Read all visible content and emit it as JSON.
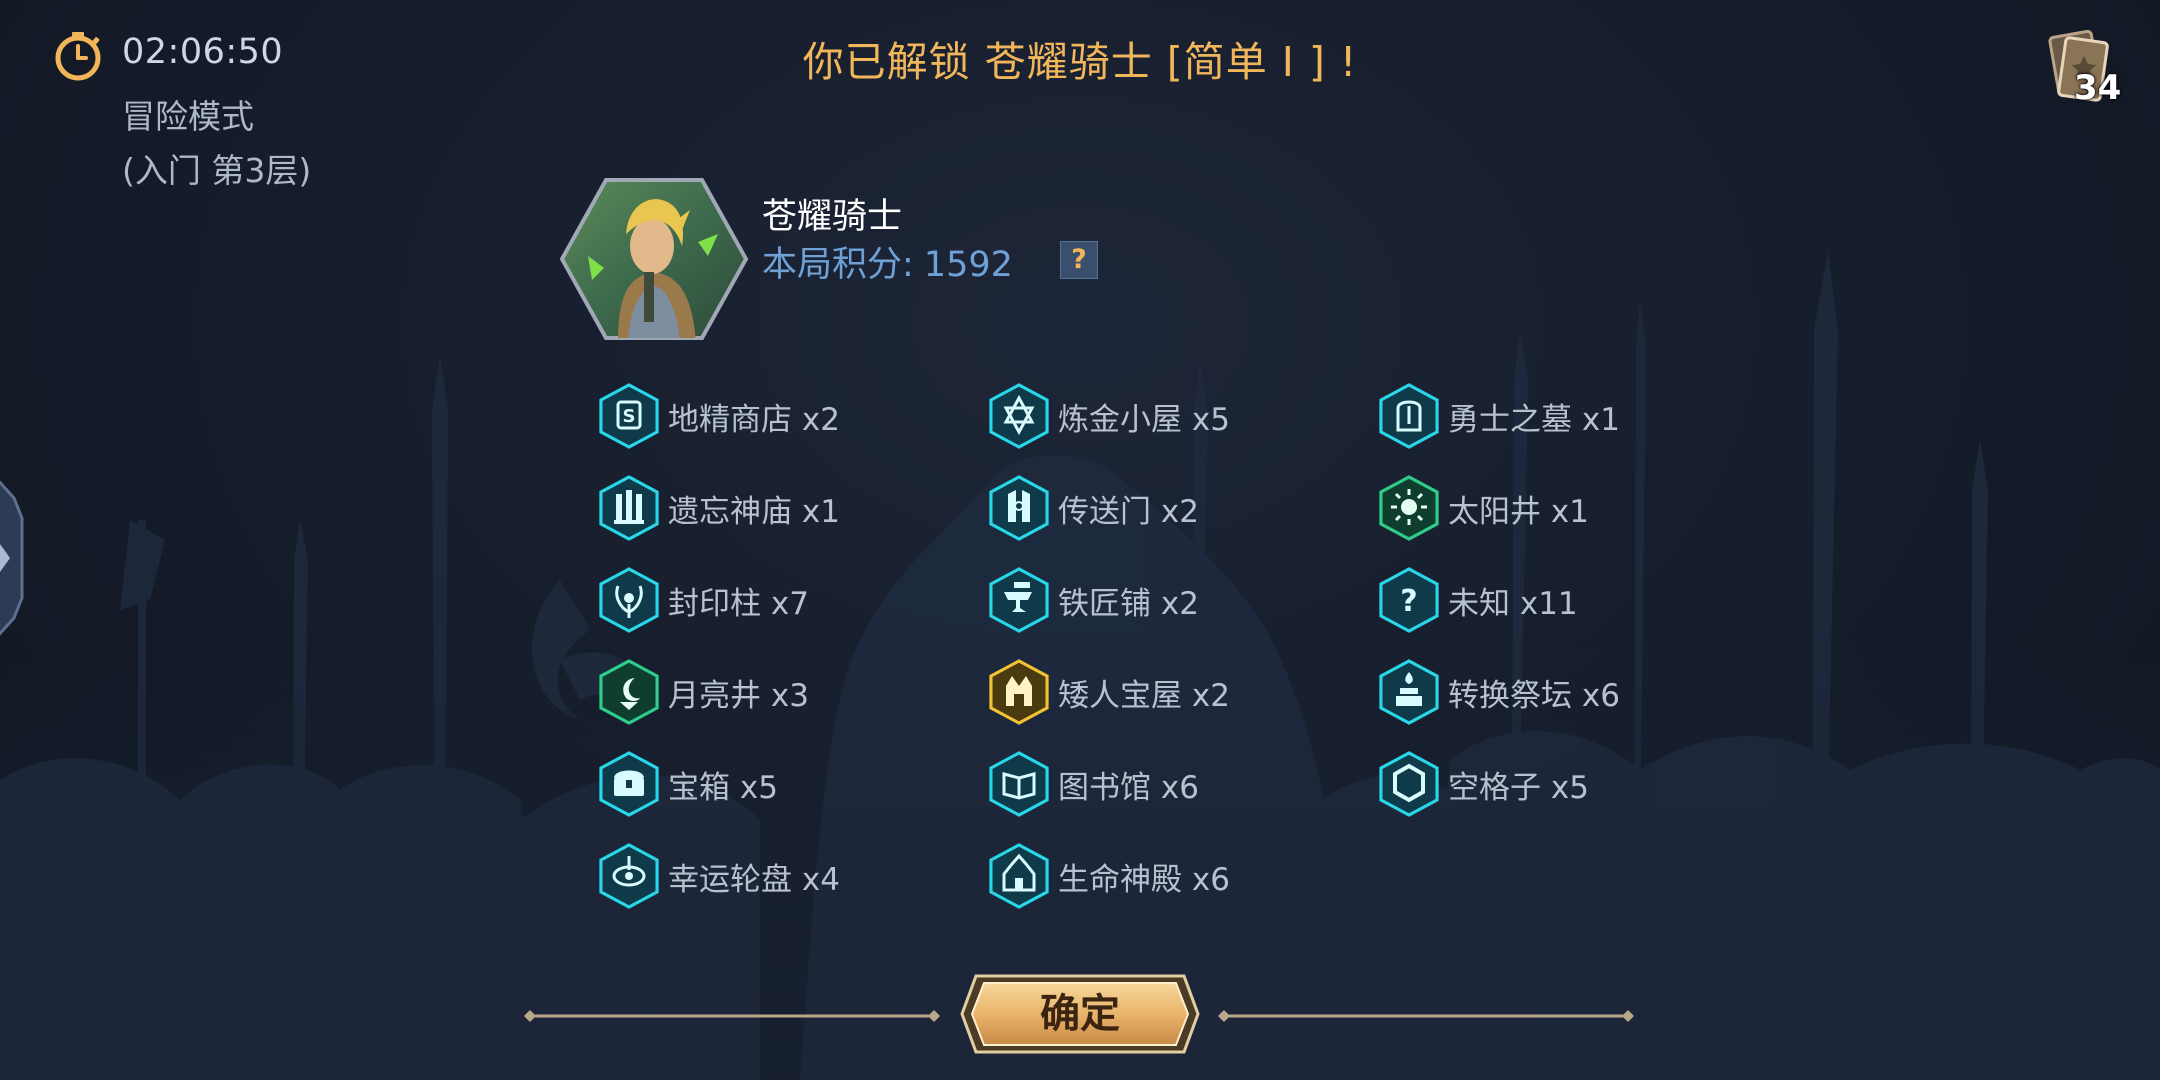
{
  "status": {
    "timer": "02:06:50",
    "mode": "冒险模式",
    "floor": "(入门 第3层)"
  },
  "title": "你已解锁 苍耀骑士 [简单 I ] !",
  "deck": {
    "count": "34"
  },
  "hero": {
    "name": "苍耀骑士",
    "score_label": "本局积分:",
    "score_value": "1592",
    "help_label": "?"
  },
  "colors": {
    "cyan": "#29d8e8",
    "green": "#2ecf8a",
    "gold": "#f1c232",
    "title": "#f1b55a"
  },
  "locations": [
    {
      "label": "地精商店 x2",
      "icon": "goblin-shop-icon",
      "color": "cyan"
    },
    {
      "label": "炼金小屋 x5",
      "icon": "alchemy-hut-icon",
      "color": "cyan"
    },
    {
      "label": "勇士之墓 x1",
      "icon": "warrior-tomb-icon",
      "color": "cyan"
    },
    {
      "label": "遗忘神庙 x1",
      "icon": "forgotten-temple-icon",
      "color": "cyan"
    },
    {
      "label": "传送门 x2",
      "icon": "portal-icon",
      "color": "cyan"
    },
    {
      "label": "太阳井 x1",
      "icon": "sun-well-icon",
      "color": "green"
    },
    {
      "label": "封印柱 x7",
      "icon": "seal-pillar-icon",
      "color": "cyan"
    },
    {
      "label": "铁匠铺 x2",
      "icon": "blacksmith-icon",
      "color": "cyan"
    },
    {
      "label": "未知 x11",
      "icon": "unknown-icon",
      "color": "cyan"
    },
    {
      "label": "月亮井 x3",
      "icon": "moon-well-icon",
      "color": "green"
    },
    {
      "label": "矮人宝屋 x2",
      "icon": "dwarf-vault-icon",
      "color": "gold"
    },
    {
      "label": "转换祭坛 x6",
      "icon": "conversion-altar-icon",
      "color": "cyan"
    },
    {
      "label": "宝箱 x5",
      "icon": "treasure-chest-icon",
      "color": "cyan"
    },
    {
      "label": "图书馆 x6",
      "icon": "library-icon",
      "color": "cyan"
    },
    {
      "label": "空格子 x5",
      "icon": "empty-cell-icon",
      "color": "cyan"
    },
    {
      "label": "幸运轮盘 x4",
      "icon": "lucky-wheel-icon",
      "color": "cyan"
    },
    {
      "label": "生命神殿 x6",
      "icon": "life-shrine-icon",
      "color": "cyan"
    }
  ],
  "confirm_label": "确定"
}
